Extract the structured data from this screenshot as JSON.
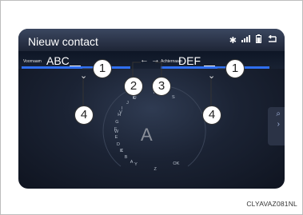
{
  "title": "Nieuw contact",
  "status_icons": [
    "bluetooth-icon",
    "signal-icon",
    "battery-icon",
    "back-icon"
  ],
  "fields": [
    {
      "label": "Voornaam",
      "value": "ABC"
    },
    {
      "label": "Achternaam",
      "value": "DEF"
    }
  ],
  "field_switch_symbol": "← →",
  "current_letter": "A",
  "left_wheel_letters": [
    "K",
    "J",
    "I",
    "H",
    "G",
    "F",
    "E",
    "D",
    "C",
    "B",
    "A"
  ],
  "right_wheel_letters": [
    "S",
    "T",
    "U",
    "V",
    "W",
    "X",
    "Y",
    "Z",
    "OK"
  ],
  "callouts": [
    "1",
    "1",
    "2",
    "3",
    "4",
    "4"
  ],
  "image_code": "CLYAVAZ081NL"
}
